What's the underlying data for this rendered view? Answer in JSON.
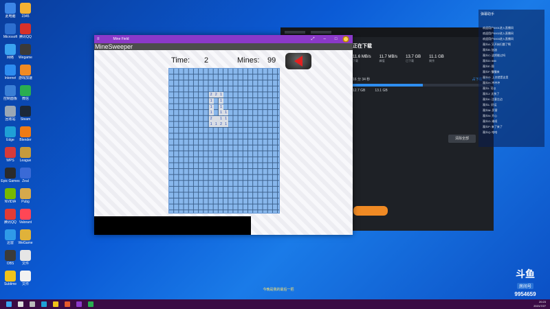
{
  "desktop": {
    "icons": [
      {
        "label": "此电脑",
        "color": "#3d86e6"
      },
      {
        "label": "2345",
        "color": "#f2b134"
      },
      {
        "label": "Microsoft",
        "color": "#2d6fd0"
      },
      {
        "label": "腾讯QQ",
        "color": "#d6312a"
      },
      {
        "label": "网络",
        "color": "#3aa3f0"
      },
      {
        "label": "Wegame",
        "color": "#3a3a3a"
      },
      {
        "label": "Internet",
        "color": "#2d8cf0"
      },
      {
        "label": "游戏加速",
        "color": "#f08a24"
      },
      {
        "label": "控制面板",
        "color": "#3a7fd6"
      },
      {
        "label": "微信",
        "color": "#2aae50"
      },
      {
        "label": "回收站",
        "color": "#9aa7b5"
      },
      {
        "label": "Steam",
        "color": "#1b2838"
      },
      {
        "label": "Edge",
        "color": "#1fa0d6"
      },
      {
        "label": "Blender",
        "color": "#f07b14"
      },
      {
        "label": "WPS",
        "color": "#d63a3a"
      },
      {
        "label": "League",
        "color": "#c59a3c"
      },
      {
        "label": "Epic Games",
        "color": "#2b2b2b"
      },
      {
        "label": "Zeal",
        "color": "#3a6ad6"
      },
      {
        "label": "NVIDIA",
        "color": "#76b900"
      },
      {
        "label": "Pubg",
        "color": "#d6a94c"
      },
      {
        "label": "腾讯QQ",
        "color": "#e13b36"
      },
      {
        "label": "Valorant",
        "color": "#ff4655"
      },
      {
        "label": "迅雷",
        "color": "#2f9ae8"
      },
      {
        "label": "WeGame",
        "color": "#e0b23a"
      },
      {
        "label": "OBS",
        "color": "#3b3b3b"
      },
      {
        "label": "文件",
        "color": "#e6e6e6"
      },
      {
        "label": "Sublime",
        "color": "#f0c21a"
      },
      {
        "label": "文件",
        "color": "#f2f2f2"
      }
    ]
  },
  "download_window": {
    "status": "正在下载",
    "stats": [
      {
        "value": "11.6 MB/s",
        "key": "下载"
      },
      {
        "value": "11.7 MB/s",
        "key": "峰值"
      },
      {
        "value": "13.7 GB",
        "key": "已下载"
      },
      {
        "value": "11.1 GB",
        "key": "剩余"
      }
    ],
    "time_left": "16 分 34 秒",
    "progress_text": "占下载 51%",
    "progress": 0.51,
    "size_a": "12.7 GB",
    "size_b": "13.1 GB",
    "pause_button": "清除全部"
  },
  "chat": {
    "header": "弹幕助手",
    "rows": [
      "欢迎用户0001进入直播间",
      "欢迎用户0002进入直播间",
      "欢迎用户0003进入直播间",
      "观众A: 又开始扫雷了啊",
      "观众B: 加油",
      "观众C: 这把能过吗",
      "观众D: 666",
      "观众E: 稳",
      "观众F: 慢慢来",
      "观众G: 上次就是这里",
      "观众H: 冲冲冲",
      "观众I: 可以",
      "观众J: 太快了",
      "观众K: 注意左边",
      "观众L: 好运",
      "观众M: 厉害",
      "观众N: 开心",
      "观众O: 继续",
      "观众P: 来了来了",
      "观众Q: 哈哈"
    ]
  },
  "minesweeper": {
    "window_title": "Mine Field",
    "app_name": "MineSweeper",
    "time_label": "Time:",
    "time_value": "2",
    "mines_label": "Mines:",
    "mines_value": "99",
    "revealed": [
      {
        "r": 4,
        "c": 8,
        "v": "2"
      },
      {
        "r": 4,
        "c": 9,
        "v": "2"
      },
      {
        "r": 4,
        "c": 10,
        "v": "1"
      },
      {
        "r": 5,
        "c": 8,
        "v": "1"
      },
      {
        "r": 5,
        "c": 10,
        "v": "1"
      },
      {
        "r": 6,
        "c": 8,
        "v": "1"
      },
      {
        "r": 6,
        "c": 10,
        "v": "1"
      },
      {
        "r": 7,
        "c": 8,
        "v": "1"
      },
      {
        "r": 7,
        "c": 10,
        "v": "1"
      },
      {
        "r": 7,
        "c": 11,
        "v": "1"
      },
      {
        "r": 8,
        "c": 8,
        "v": "2"
      },
      {
        "r": 8,
        "c": 9,
        "v": ""
      },
      {
        "r": 8,
        "c": 10,
        "v": "1"
      },
      {
        "r": 8,
        "c": 11,
        "v": "1"
      },
      {
        "r": 9,
        "c": 8,
        "v": "1"
      },
      {
        "r": 9,
        "c": 9,
        "v": "1"
      },
      {
        "r": 9,
        "c": 10,
        "v": "2"
      },
      {
        "r": 9,
        "c": 11,
        "v": "1"
      }
    ]
  },
  "overlay": {
    "subtitle": "今晚是我的最后一把",
    "logo": "斗鱼",
    "room_label": "房间号",
    "room_number": "9954659"
  },
  "taskbar": {
    "time": "20:23",
    "date": "2021/7/27"
  }
}
